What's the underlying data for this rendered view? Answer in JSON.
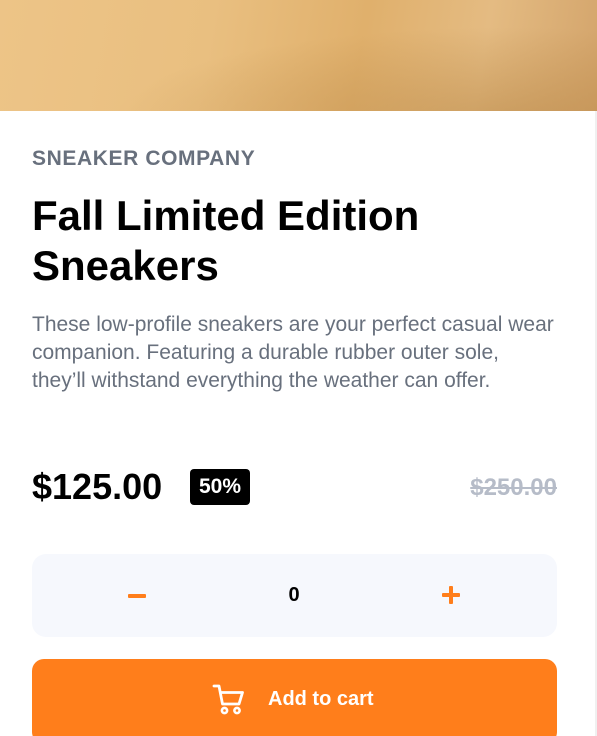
{
  "product": {
    "company": "SNEAKER COMPANY",
    "title": "Fall Limited Edition Sneakers",
    "description": "These low-profile sneakers are your perfect casual wear companion. Featuring a durable rubber outer sole, they’ll withstand everything the weather can offer.",
    "price": "$125.00",
    "discount": "50%",
    "original_price": "$250.00"
  },
  "quantity": {
    "value": "0",
    "minus_icon": "minus-icon",
    "plus_icon": "plus-icon"
  },
  "cart_button": {
    "label": "Add to cart",
    "icon": "cart-icon"
  },
  "colors": {
    "accent": "#ff7e1b",
    "text_dark": "#000000",
    "text_muted": "#68707d",
    "strike_price": "#b6bcc8",
    "quantity_bg": "#f6f8fd"
  }
}
